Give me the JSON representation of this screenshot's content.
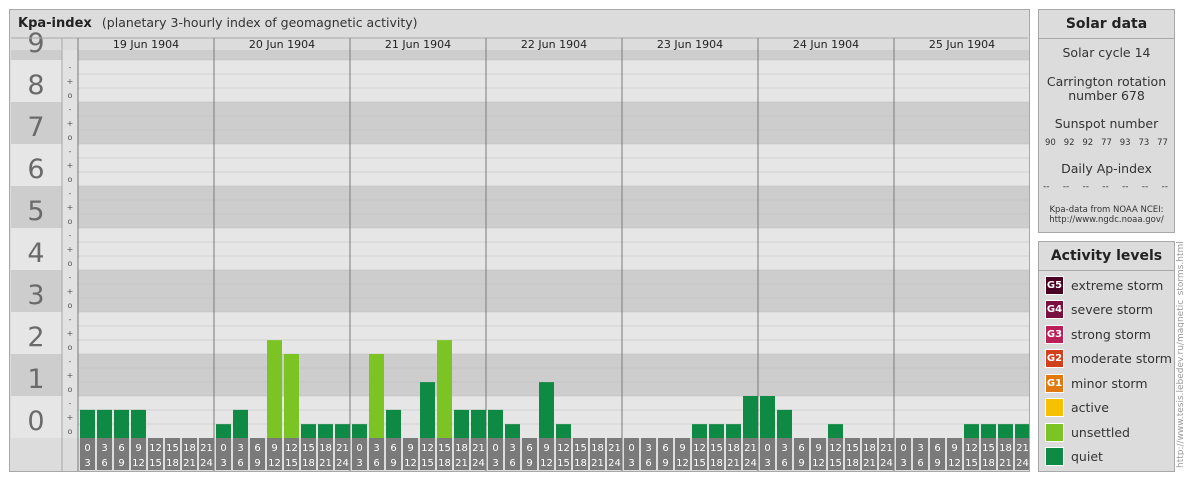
{
  "header": {
    "title": "Kpa-index",
    "subtitle": "(planetary 3-hourly index of geomagnetic activity)"
  },
  "solar": {
    "title": "Solar data",
    "cycle": "Solar cycle 14",
    "carrington_line1": "Carrington rotation",
    "carrington_line2": "number 678",
    "sunspot_label": "Sunspot number",
    "sunspots": [
      "90",
      "92",
      "92",
      "77",
      "93",
      "73",
      "77"
    ],
    "ap_label": "Daily Ap-index",
    "ap_values": [
      "--",
      "--",
      "--",
      "--",
      "--",
      "--",
      "--"
    ],
    "credit_line1": "Kpa-data from NOAA NCEI:",
    "credit_line2": "http://www.ngdc.noaa.gov/"
  },
  "activity": {
    "title": "Activity levels",
    "levels": [
      {
        "code": "G5",
        "label": "extreme storm",
        "color": "#4a0020"
      },
      {
        "code": "G4",
        "label": "severe storm",
        "color": "#7a1040"
      },
      {
        "code": "G3",
        "label": "strong storm",
        "color": "#b8205a"
      },
      {
        "code": "G2",
        "label": "moderate storm",
        "color": "#d0401a"
      },
      {
        "code": "G1",
        "label": "minor storm",
        "color": "#e07a10"
      },
      {
        "code": "",
        "label": "active",
        "color": "#f4c000"
      },
      {
        "code": "",
        "label": "unsettled",
        "color": "#7cc424"
      },
      {
        "code": "",
        "label": "quiet",
        "color": "#0e8a45"
      }
    ]
  },
  "watermark": "http://www.tesis.lebedev.ru/magnetic_storms.html",
  "chart_data": {
    "type": "bar",
    "ylabel_ticks": [
      "0",
      "1",
      "2",
      "3",
      "4",
      "5",
      "6",
      "7",
      "8",
      "9"
    ],
    "sub_ticks": [
      "o",
      "+",
      "-"
    ],
    "ylim": [
      0,
      9.33
    ],
    "days": [
      "19 Jun 1904",
      "20 Jun 1904",
      "21 Jun 1904",
      "22 Jun 1904",
      "23 Jun 1904",
      "24 Jun 1904",
      "25 Jun 1904"
    ],
    "interval_start": [
      "0",
      "3",
      "6",
      "9",
      "12",
      "15",
      "18",
      "21"
    ],
    "interval_end": [
      "3",
      "6",
      "9",
      "12",
      "15",
      "18",
      "21",
      "24"
    ],
    "values": [
      [
        0.67,
        0.67,
        0.67,
        0.67,
        0,
        0,
        0,
        0
      ],
      [
        0.33,
        0.67,
        0,
        2.33,
        2.0,
        0.33,
        0.33,
        0.33
      ],
      [
        0.33,
        2.0,
        0.67,
        0,
        1.33,
        2.33,
        0.67,
        0.67
      ],
      [
        0.67,
        0.33,
        0,
        1.33,
        0.33,
        0,
        0,
        0
      ],
      [
        0,
        0,
        0,
        0,
        0.33,
        0.33,
        0.33,
        1.0
      ],
      [
        1.0,
        0.67,
        0,
        0,
        0.33,
        0,
        0,
        0
      ],
      [
        0,
        0,
        0,
        0,
        0.33,
        0.33,
        0.33,
        0.33
      ]
    ],
    "colors": {
      "quiet": "#0e8a45",
      "unsettled": "#7cc424"
    }
  }
}
